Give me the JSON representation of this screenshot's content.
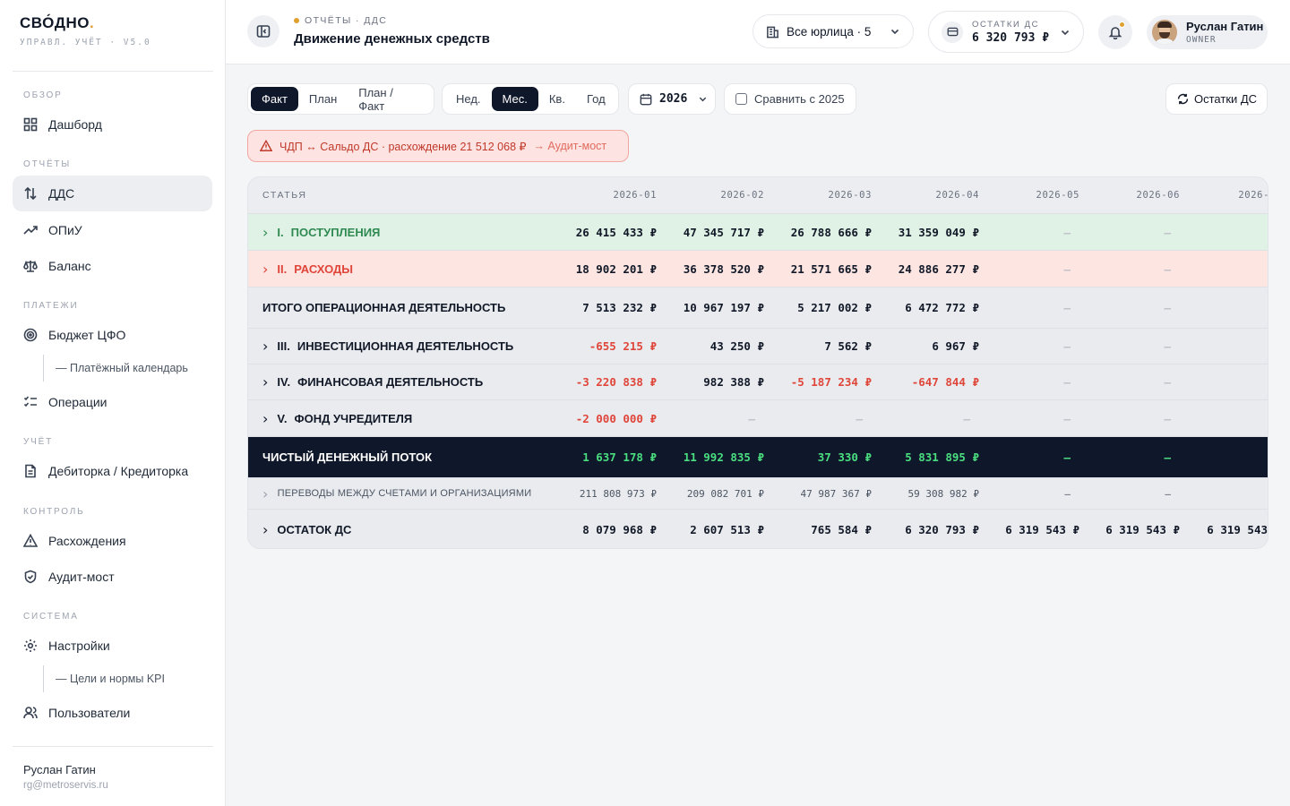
{
  "sidebar": {
    "brand": "СВО́ДНО",
    "brand_dot": ".",
    "tagline": "УПРАВЛ. УЧЁТ · V5.0",
    "sections": {
      "overview": "ОБЗОР",
      "reports": "ОТЧЁТЫ",
      "payments": "ПЛАТЕЖИ",
      "accounting": "УЧЁТ",
      "control": "КОНТРОЛЬ",
      "system": "СИСТЕМА"
    },
    "items": {
      "dashboard": "Дашборд",
      "dds": "ДДС",
      "opiu": "ОПиУ",
      "balance": "Баланс",
      "budget": "Бюджет ЦФО",
      "payment_calendar": "— Платёжный календарь",
      "operations": "Операции",
      "receivables": "Дебиторка / Кредиторка",
      "discrepancies": "Расхождения",
      "audit_bridge": "Аудит-мост",
      "settings": "Настройки",
      "kpi": "— Цели и нормы KPI",
      "users": "Пользователи"
    },
    "user": {
      "name": "Руслан Гатин",
      "email": "rg@metroservis.ru"
    }
  },
  "header": {
    "breadcrumb": "ОТЧЁТЫ · ДДС",
    "title": "Движение денежных средств",
    "entity_selector": "Все юрлица · 5",
    "balance_label": "ОСТАТКИ ДС",
    "balance_value": "6 320 793 ₽",
    "user_name": "Руслан Гатин",
    "user_role": "OWNER"
  },
  "toolbar": {
    "mode_tabs": [
      "Факт",
      "План",
      "План / Факт"
    ],
    "mode_active": "Факт",
    "period_tabs": [
      "Нед.",
      "Мес.",
      "Кв.",
      "Год"
    ],
    "period_active": "Мес.",
    "year": "2026",
    "compare_label": "Сравнить с 2025",
    "compare_checked": false,
    "refresh_label": "Остатки ДС"
  },
  "alert": {
    "text": "ЧДП ↔ Сальдо ДС · расхождение 21 512 068 ₽",
    "link": "→ Аудит-мост"
  },
  "table": {
    "header_label": "СТАТЬЯ",
    "columns": [
      "2026-01",
      "2026-02",
      "2026-03",
      "2026-04",
      "2026-05",
      "2026-06",
      "2026-"
    ],
    "rows": [
      {
        "prefix": "I.",
        "label": "ПОСТУПЛЕНИЯ",
        "values": [
          "26 415 433 ₽",
          "47 345 717 ₽",
          "26 788 666 ₽",
          "31 359 049 ₽",
          "—",
          "—",
          ""
        ]
      },
      {
        "prefix": "II.",
        "label": "РАСХОДЫ",
        "values": [
          "18 902 201 ₽",
          "36 378 520 ₽",
          "21 571 665 ₽",
          "24 886 277 ₽",
          "—",
          "—",
          ""
        ]
      },
      {
        "prefix": "",
        "label": "ИТОГО ОПЕРАЦИОННАЯ ДЕЯТЕЛЬНОСТЬ",
        "values": [
          "7 513 232 ₽",
          "10 967 197 ₽",
          "5 217 002 ₽",
          "6 472 772 ₽",
          "—",
          "—",
          ""
        ]
      },
      {
        "prefix": "III.",
        "label": "ИНВЕСТИЦИОННАЯ ДЕЯТЕЛЬНОСТЬ",
        "values": [
          "-655 215 ₽",
          "43 250 ₽",
          "7 562 ₽",
          "6 967 ₽",
          "—",
          "—",
          ""
        ]
      },
      {
        "prefix": "IV.",
        "label": "ФИНАНСОВАЯ ДЕЯТЕЛЬНОСТЬ",
        "values": [
          "-3 220 838 ₽",
          "982 388 ₽",
          "-5 187 234 ₽",
          "-647 844 ₽",
          "—",
          "—",
          ""
        ]
      },
      {
        "prefix": "V.",
        "label": "ФОНД УЧРЕДИТЕЛЯ",
        "values": [
          "-2 000 000 ₽",
          "—",
          "—",
          "—",
          "—",
          "—",
          ""
        ]
      },
      {
        "prefix": "",
        "label": "ЧИСТЫЙ ДЕНЕЖНЫЙ ПОТОК",
        "values": [
          "1 637 178 ₽",
          "11 992 835 ₽",
          "37 330 ₽",
          "5 831 895 ₽",
          "—",
          "—",
          ""
        ]
      },
      {
        "prefix": "",
        "label": "ПЕРЕВОДЫ МЕЖДУ СЧЕТАМИ И ОРГАНИЗАЦИЯМИ",
        "values": [
          "211 808 973 ₽",
          "209 082 701 ₽",
          "47 987 367 ₽",
          "59 308 982 ₽",
          "—",
          "—",
          ""
        ]
      },
      {
        "prefix": "",
        "label": "ОСТАТОК ДС",
        "values": [
          "8 079 968 ₽",
          "2 607 513 ₽",
          "765 584 ₽",
          "6 320 793 ₽",
          "6 319 543 ₽",
          "6 319 543 ₽",
          "6 319 543"
        ]
      }
    ]
  },
  "colors": {
    "accent": "#e0a030",
    "income": "#2f8a52",
    "expense": "#e0453a",
    "net_row_bg": "#0f172a",
    "net_value": "#4ade80"
  }
}
